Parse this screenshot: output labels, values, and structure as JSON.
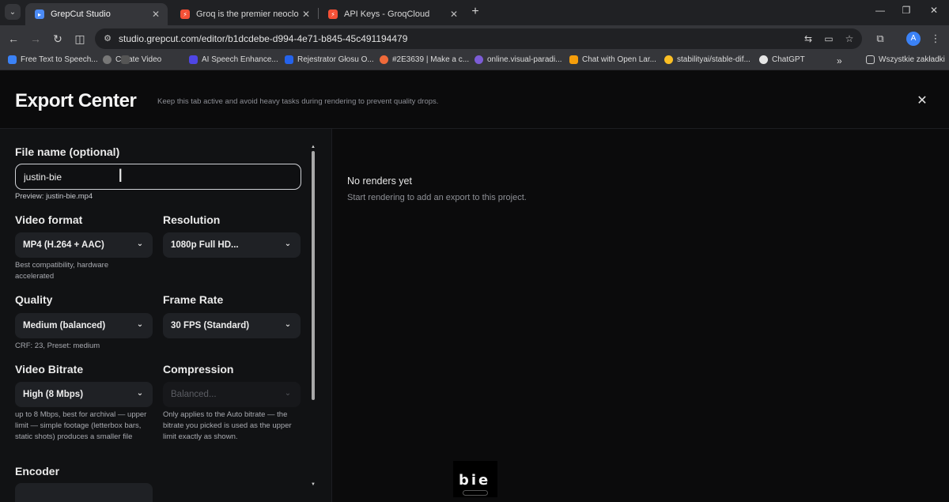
{
  "browser": {
    "tabs": [
      {
        "title": "GrepCut Studio",
        "active": true,
        "favicon_color": "#4c8bf5"
      },
      {
        "title": "Groq is the premier neocloud fo",
        "active": false,
        "favicon_color": "#f55036"
      },
      {
        "title": "API Keys - GroqCloud",
        "active": false,
        "favicon_color": "#f55036"
      }
    ],
    "url": "studio.grepcut.com/editor/b1dcdebe-d994-4e71-b845-45c491194479",
    "profile_initial": "A",
    "bookmarks": [
      {
        "label": "Free Text to Speech...",
        "color": "#3b82f6"
      },
      {
        "label": "Create Video",
        "color": "#777"
      },
      {
        "label": "AI Speech Enhance...",
        "color": "#4f46e5"
      },
      {
        "label": "Rejestrator Głosu O...",
        "color": "#2563eb"
      },
      {
        "label": "#2E3639 | Make a c...",
        "color": "#ef6a3a"
      },
      {
        "label": "online.visual-paradi...",
        "color": "#7c5cd6"
      },
      {
        "label": "Chat with Open Lar...",
        "color": "#f59e0b"
      },
      {
        "label": "stabilityai/stable-dif...",
        "color": "#fbbf24"
      },
      {
        "label": "ChatGPT",
        "color": "#e5e5e5"
      }
    ],
    "all_bookmarks_label": "Wszystkie zakładki"
  },
  "export": {
    "title": "Export Center",
    "subtitle": "Keep this tab active and avoid heavy tasks during rendering to prevent quality drops.",
    "file_name_label": "File name (optional)",
    "file_name_value": "justin-bie",
    "preview": "Preview: justin-bie.mp4",
    "video_format": {
      "label": "Video format",
      "value": "MP4 (H.264 + AAC)",
      "hint": "Best compatibility, hardware accelerated"
    },
    "resolution": {
      "label": "Resolution",
      "value": "1080p Full HD..."
    },
    "quality": {
      "label": "Quality",
      "value": "Medium (balanced)",
      "hint": "CRF: 23, Preset: medium"
    },
    "frame_rate": {
      "label": "Frame Rate",
      "value": "30 FPS (Standard)"
    },
    "video_bitrate": {
      "label": "Video Bitrate",
      "value": "High (8 Mbps)",
      "hint": "up to 8 Mbps, best for archival — upper limit — simple footage (letterbox bars, static shots) produces a smaller file"
    },
    "compression": {
      "label": "Compression",
      "value": "Balanced...",
      "hint": "Only applies to the Auto bitrate — the bitrate you picked is used as the upper limit exactly as shown."
    },
    "encoder_label": "Encoder",
    "empty_title": "No renders yet",
    "empty_sub": "Start rendering to add an export to this project."
  },
  "caption": "bie"
}
